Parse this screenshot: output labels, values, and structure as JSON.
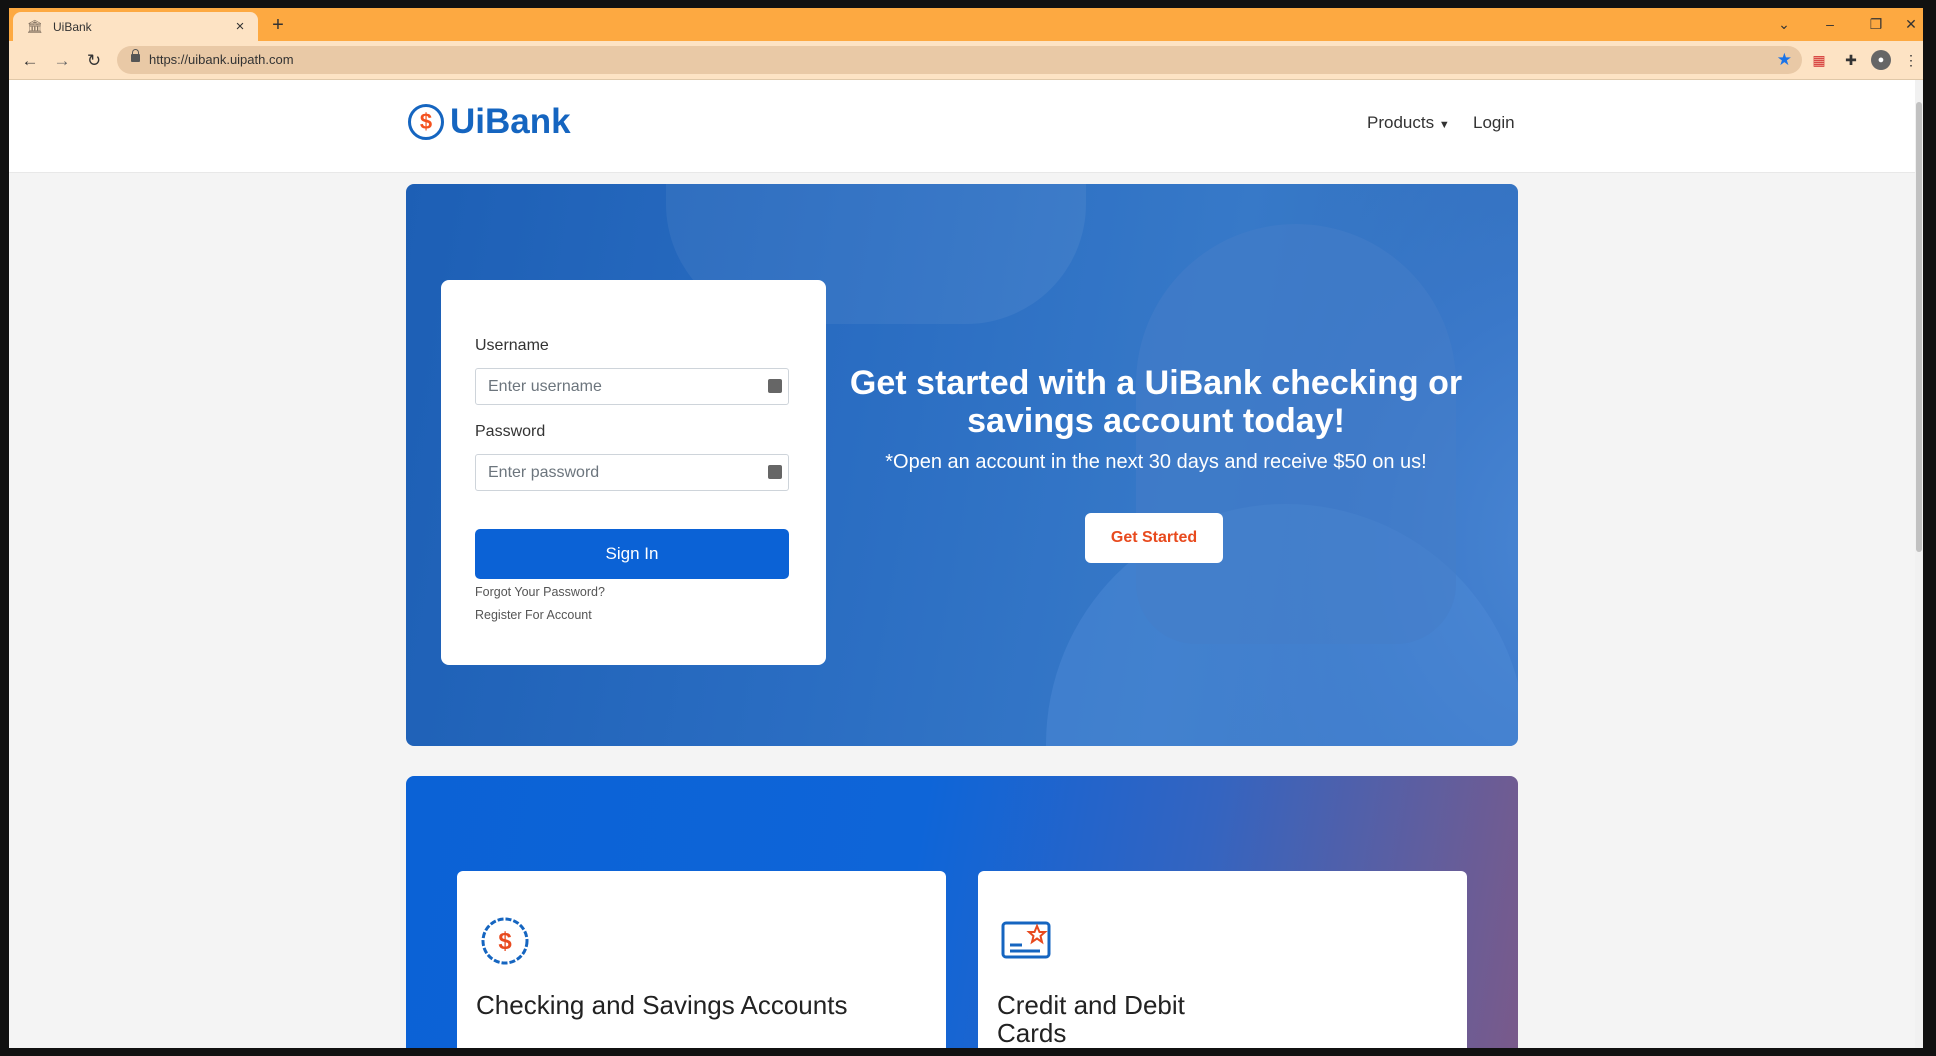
{
  "browser": {
    "tab_title": "UiBank",
    "url": "https://uibank.uipath.com",
    "new_tab": "+",
    "tab_close": "×"
  },
  "header": {
    "logo_symbol": "$",
    "logo_text": "UiBank",
    "nav": {
      "products": "Products",
      "login": "Login"
    }
  },
  "login": {
    "username_label": "Username",
    "username_placeholder": "Enter username",
    "password_label": "Password",
    "password_placeholder": "Enter password",
    "signin_label": "Sign In",
    "forgot_link": "Forgot Your Password?",
    "register_link": "Register For Account"
  },
  "hero": {
    "title": "Get started with a UiBank checking or savings account today!",
    "subtitle": "*Open an account in the next 30 days and receive $50 on us!",
    "cta": "Get Started"
  },
  "products": {
    "cards": [
      {
        "title": "Checking and Savings Accounts",
        "icon": "dollar-badge-icon"
      },
      {
        "title": "Credit and Debit Cards",
        "icon": "credit-card-star-icon"
      }
    ]
  },
  "colors": {
    "brand_blue": "#1565c0",
    "accent_orange": "#e84a1e",
    "chrome_orange": "#fda941"
  }
}
